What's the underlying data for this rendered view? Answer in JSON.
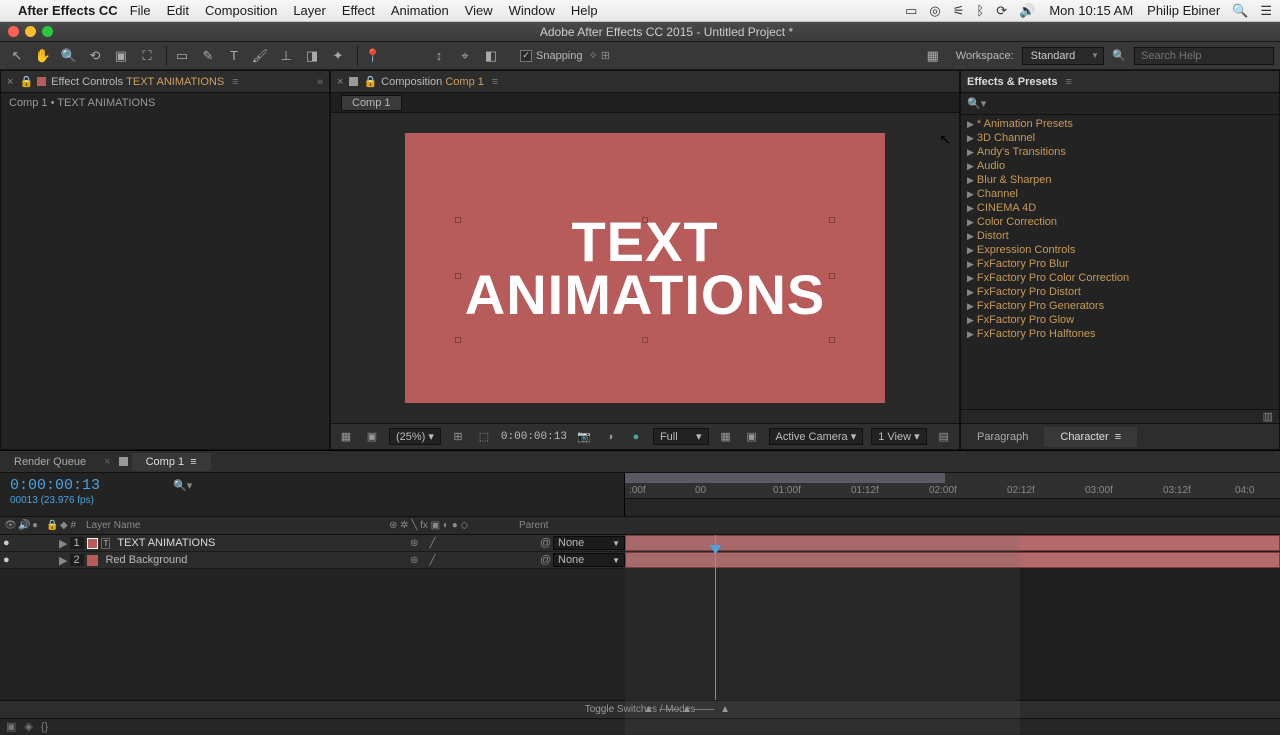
{
  "menubar": {
    "app_name": "After Effects CC",
    "items": [
      "File",
      "Edit",
      "Composition",
      "Layer",
      "Effect",
      "Animation",
      "View",
      "Window",
      "Help"
    ],
    "clock": "Mon 10:15 AM",
    "user": "Philip Ebiner"
  },
  "window": {
    "title": "Adobe After Effects CC 2015 - Untitled Project *"
  },
  "toolbar": {
    "snapping_label": "Snapping",
    "workspace_label": "Workspace:",
    "workspace_value": "Standard",
    "search_placeholder": "Search Help"
  },
  "effect_controls": {
    "title_prefix": "Effect Controls",
    "title_subject": "TEXT ANIMATIONS",
    "breadcrumb": "Comp 1 • TEXT ANIMATIONS"
  },
  "composition": {
    "panel_label": "Composition",
    "panel_subject": "Comp 1",
    "tab": "Comp 1",
    "text_line1": "TEXT",
    "text_line2": "ANIMATIONS",
    "footer": {
      "zoom": "(25%)",
      "timecode": "0:00:00:13",
      "resolution": "Full",
      "camera": "Active Camera",
      "view": "1 View"
    }
  },
  "effects_panel": {
    "title": "Effects & Presets",
    "items": [
      "* Animation Presets",
      "3D Channel",
      "Andy's Transitions",
      "Audio",
      "Blur & Sharpen",
      "Channel",
      "CINEMA 4D",
      "Color Correction",
      "Distort",
      "Expression Controls",
      "FxFactory Pro Blur",
      "FxFactory Pro Color Correction",
      "FxFactory Pro Distort",
      "FxFactory Pro Generators",
      "FxFactory Pro Glow",
      "FxFactory Pro Halftones"
    ],
    "paragraph_tab": "Paragraph",
    "character_tab": "Character"
  },
  "timeline": {
    "render_tab": "Render Queue",
    "comp_tab": "Comp 1",
    "timecode": "0:00:00:13",
    "frames": "00013 (23.976 fps)",
    "col_layer": "Layer Name",
    "col_parent": "Parent",
    "ticks": [
      ":00f",
      "00",
      "01:00f",
      "01:12f",
      "02:00f",
      "02:12f",
      "03:00f",
      "03:12f",
      "04:0"
    ],
    "layers": [
      {
        "num": "1",
        "name": "TEXT ANIMATIONS",
        "color": "#b85b5b",
        "parent": "None",
        "type": "text"
      },
      {
        "num": "2",
        "name": "Red Background",
        "color": "#b85b5b",
        "parent": "None",
        "type": "solid"
      }
    ],
    "footer": "Toggle Switches / Modes"
  }
}
